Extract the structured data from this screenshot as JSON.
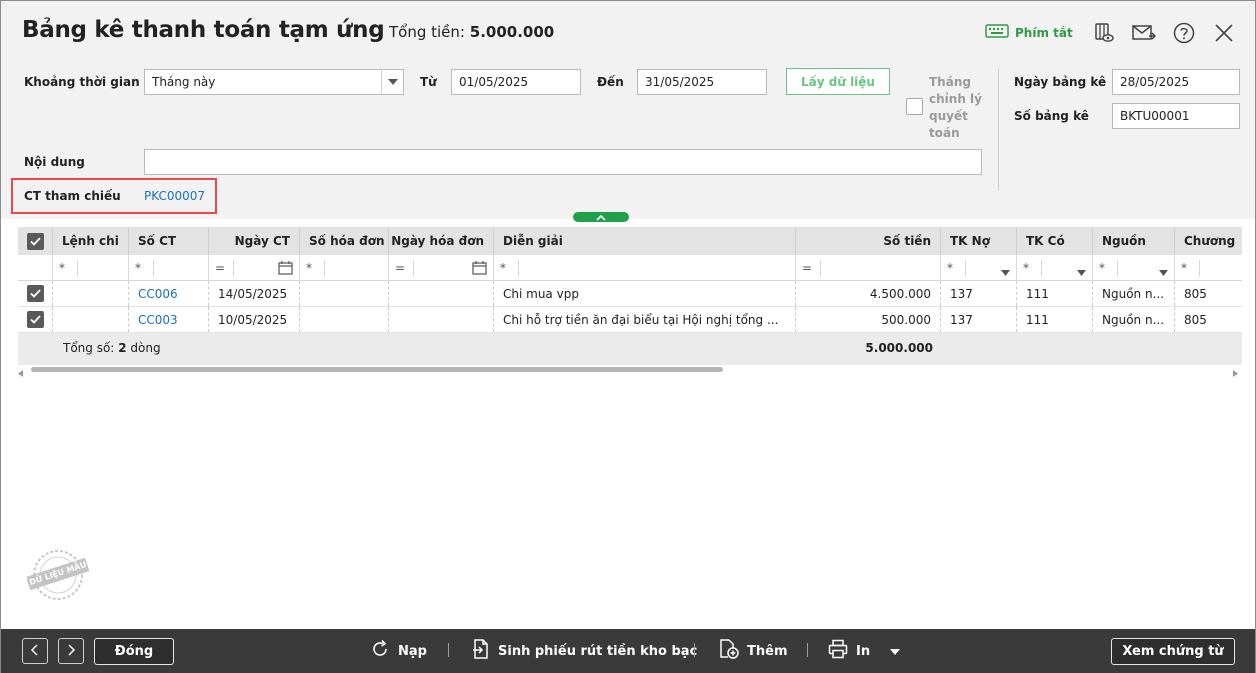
{
  "window": {
    "title": "Bảng kê thanh toán tạm ứng",
    "total_label": "Tổng tiền:",
    "total_value": "5.000.000",
    "shortcut_label": "Phím tắt"
  },
  "form": {
    "period_label": "Khoảng thời gian",
    "period_value": "Tháng này",
    "from_label": "Từ",
    "from_value": "01/05/2025",
    "to_label": "Đến",
    "to_value": "31/05/2025",
    "fetch_label": "Lấy dữ liệu",
    "adjust_month_label": [
      "Tháng",
      "chỉnh lý",
      "quyết",
      "toán"
    ],
    "report_date_label": "Ngày bảng kê",
    "report_date_value": "28/05/2025",
    "report_no_label": "Số bảng kê",
    "report_no_value": "BKTU00001",
    "content_label": "Nội dung",
    "content_value": "",
    "ref_label": "CT tham chiếu",
    "ref_value": "PKC00007"
  },
  "table": {
    "columns": [
      "Lệnh chi",
      "Số CT",
      "Ngày CT",
      "Số hóa đơn",
      "Ngày hóa đơn",
      "Diễn giải",
      "Số tiền",
      "TK Nợ",
      "TK Có",
      "Nguồn",
      "Chương"
    ],
    "filters": [
      "*",
      "*",
      "=",
      "*",
      "=",
      "*",
      "=",
      "*",
      "*",
      "*",
      "*"
    ],
    "rows": [
      {
        "lenh_chi": "",
        "so_ct": "CC006",
        "ngay_ct": "14/05/2025",
        "so_hd": "",
        "ngay_hd": "",
        "dien_giai": "Chi mua vpp",
        "so_tien": "4.500.000",
        "tk_no": "137",
        "tk_co": "111",
        "nguon": "Nguồn n...",
        "chuong": "805"
      },
      {
        "lenh_chi": "",
        "so_ct": "CC003",
        "ngay_ct": "10/05/2025",
        "so_hd": "",
        "ngay_hd": "",
        "dien_giai": "Chi hỗ trợ tiền ăn đại biểu tại Hội nghị tổng ...",
        "so_tien": "500.000",
        "tk_no": "137",
        "tk_co": "111",
        "nguon": "Nguồn n...",
        "chuong": "805"
      }
    ],
    "footer_label": "Tổng số:",
    "footer_count": "2",
    "footer_unit": "dòng",
    "footer_total": "5.000.000"
  },
  "watermark": "DỮ LIỆU MẪU",
  "bottombar": {
    "close_label": "Đóng",
    "reload_label": "Nạp",
    "generate_label": "Sinh phiếu rút tiền kho bạc",
    "add_label": "Thêm",
    "print_label": "In",
    "view_label": "Xem chứng từ"
  },
  "colors": {
    "accent_green": "#21a04a",
    "link_blue": "#1a6fc4",
    "highlight_red": "#e84a4a",
    "bar_dark": "#3a3a3a"
  }
}
